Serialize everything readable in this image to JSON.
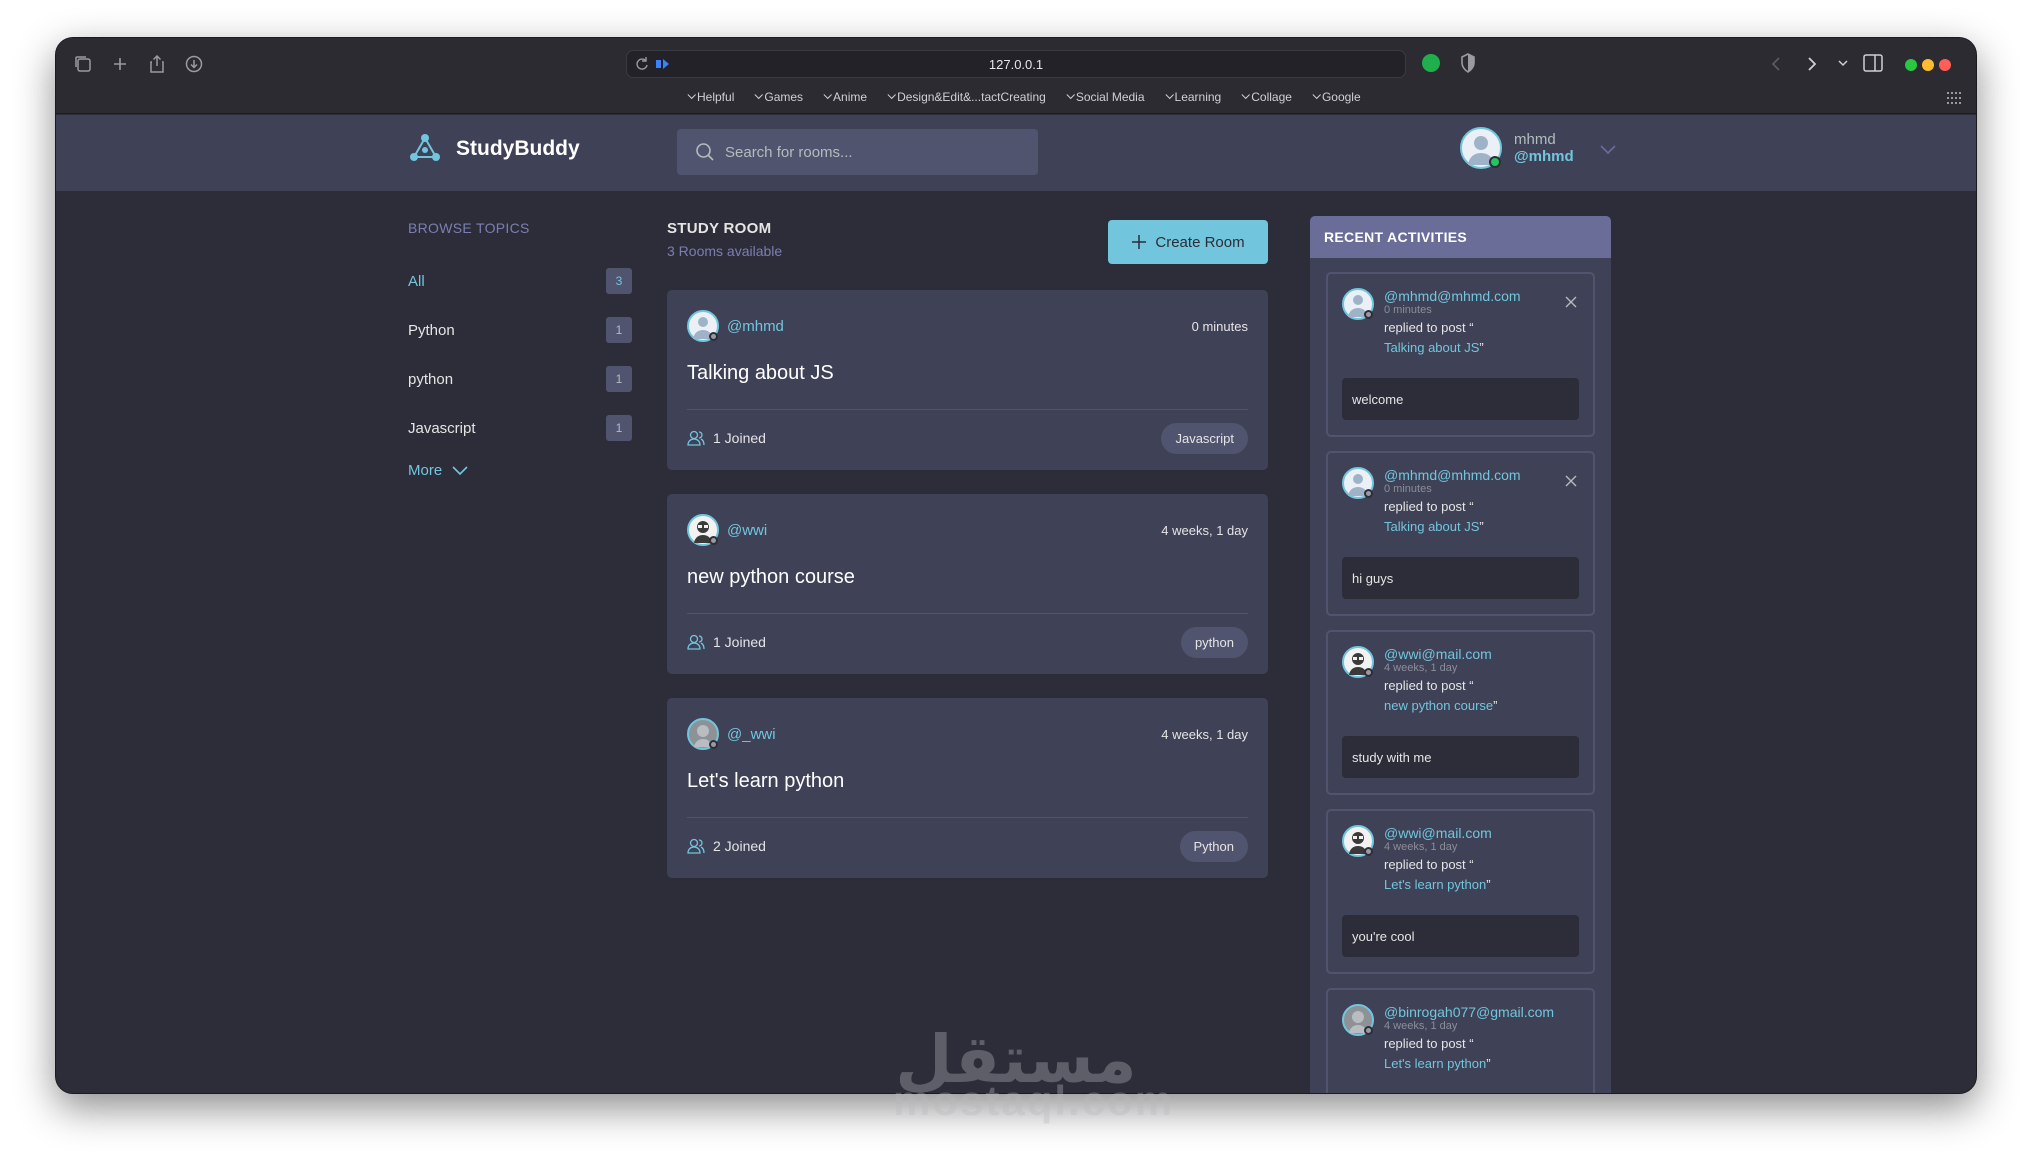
{
  "browser": {
    "url": "127.0.0.1",
    "bookmarks": [
      "Helpful",
      "Games",
      "Anime",
      "Design&Edit&...tactCreating",
      "Social Media",
      "Learning",
      "Collage",
      "Google"
    ]
  },
  "header": {
    "brand": "StudyBuddy",
    "search_placeholder": "Search for rooms...",
    "user_name": "mhmd",
    "user_handle": "@mhmd"
  },
  "sidebar": {
    "title": "BROWSE TOPICS",
    "topics": [
      {
        "label": "All",
        "count": "3"
      },
      {
        "label": "Python",
        "count": "1"
      },
      {
        "label": "python",
        "count": "1"
      },
      {
        "label": "Javascript",
        "count": "1"
      }
    ],
    "more_label": "More"
  },
  "main": {
    "title": "STUDY ROOM",
    "subtitle": "3 Rooms available",
    "create_label": "Create Room",
    "rooms": [
      {
        "host": "@mhmd",
        "time": "0 minutes",
        "title": "Talking about JS",
        "joined": "1 Joined",
        "topic": "Javascript"
      },
      {
        "host": "@wwi",
        "time": "4 weeks, 1 day",
        "title": "new python course",
        "joined": "1 Joined",
        "topic": "python"
      },
      {
        "host": "@_wwi",
        "time": "4 weeks, 1 day",
        "title": "Let's learn python",
        "joined": "2 Joined",
        "topic": "Python"
      }
    ]
  },
  "activities": {
    "title": "RECENT ACTIVITIES",
    "items": [
      {
        "user": "@mhmd@mhmd.com",
        "ago": "0 minutes",
        "action": "replied to post “",
        "post": "Talking about JS",
        "close_quote": "”",
        "message": "welcome"
      },
      {
        "user": "@mhmd@mhmd.com",
        "ago": "0 minutes",
        "action": "replied to post “",
        "post": "Talking about JS",
        "close_quote": "”",
        "message": "hi guys"
      },
      {
        "user": "@wwi@mail.com",
        "ago": "4 weeks, 1 day",
        "action": "replied to post “",
        "post": "new python course",
        "close_quote": "”",
        "message": "study with me"
      },
      {
        "user": "@wwi@mail.com",
        "ago": "4 weeks, 1 day",
        "action": "replied to post “",
        "post": "Let's learn python",
        "close_quote": "”",
        "message": "you're cool"
      },
      {
        "user": "@binrogah077@gmail.com",
        "ago": "4 weeks, 1 day",
        "action": "replied to post “",
        "post": "Let's learn python",
        "close_quote": "”",
        "message": ""
      }
    ]
  },
  "watermark": {
    "arabic": "مستقل",
    "latin": "mostaql.com"
  },
  "colors": {
    "accent": "#71c6dd",
    "bg": "#2d2d39",
    "card": "#3f4156",
    "panel_header": "#696d97",
    "muted": "#7a7fb0"
  }
}
